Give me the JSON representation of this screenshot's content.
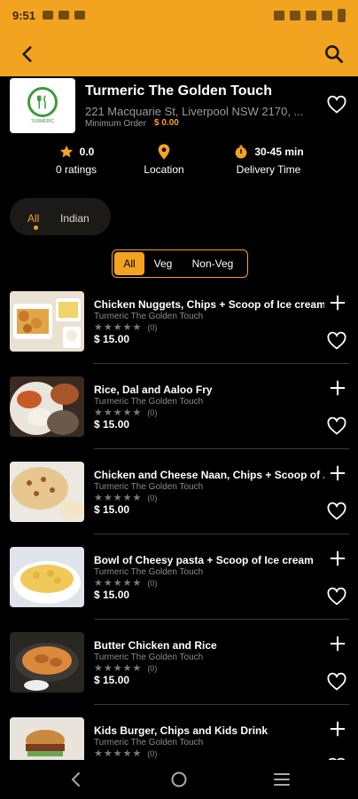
{
  "status": {
    "time": "9:51"
  },
  "restaurant": {
    "name": "Turmeric The Golden Touch",
    "address": "221 Macquarie St, Liverpool NSW 2170, ...",
    "min_order_label": "Minimum Order",
    "min_order_value": "$ 0.00",
    "logo_text": "TURMERIC"
  },
  "stats": {
    "rating_value": "0.0",
    "rating_label": "0 ratings",
    "location_label": "Location",
    "delivery_value": "30-45 min",
    "delivery_label": "Delivery Time"
  },
  "cuisine_tabs": [
    "All",
    "Indian"
  ],
  "filters": [
    "All",
    "Veg",
    "Non-Veg"
  ],
  "items": [
    {
      "name": "Chicken Nuggets, Chips + Scoop of Ice cream",
      "sub": "Turmeric The Golden Touch",
      "rating_count": "(0)",
      "price": "$ 15.00",
      "stars": 0
    },
    {
      "name": "Rice, Dal and Aaloo Fry",
      "sub": "Turmeric The Golden Touch",
      "rating_count": "(0)",
      "price": "$ 15.00",
      "stars": 0
    },
    {
      "name": "Chicken and Cheese Naan, Chips + Scoop of ...",
      "sub": "Turmeric The Golden Touch",
      "rating_count": "(0)",
      "price": "$ 15.00",
      "stars": 0
    },
    {
      "name": "Bowl of Cheesy pasta + Scoop of Ice cream",
      "sub": "Turmeric The Golden Touch",
      "rating_count": "(0)",
      "price": "$ 15.00",
      "stars": 0
    },
    {
      "name": "Butter Chicken and Rice",
      "sub": "Turmeric The Golden Touch",
      "rating_count": "(0)",
      "price": "$ 15.00",
      "stars": 0
    },
    {
      "name": "Kids Burger, Chips and Kids Drink",
      "sub": "Turmeric The Golden Touch",
      "rating_count": "(0)",
      "price": "",
      "stars": 0
    }
  ],
  "icons": {
    "back": "arrow-left-icon",
    "search": "search-icon",
    "heart": "heart-outline-icon",
    "star": "star-icon",
    "location": "location-pin-icon",
    "timer": "timer-icon",
    "plus": "plus-icon"
  },
  "colors": {
    "accent": "#f2a31f",
    "background": "#000000",
    "muted_text": "#9a9a9a"
  }
}
